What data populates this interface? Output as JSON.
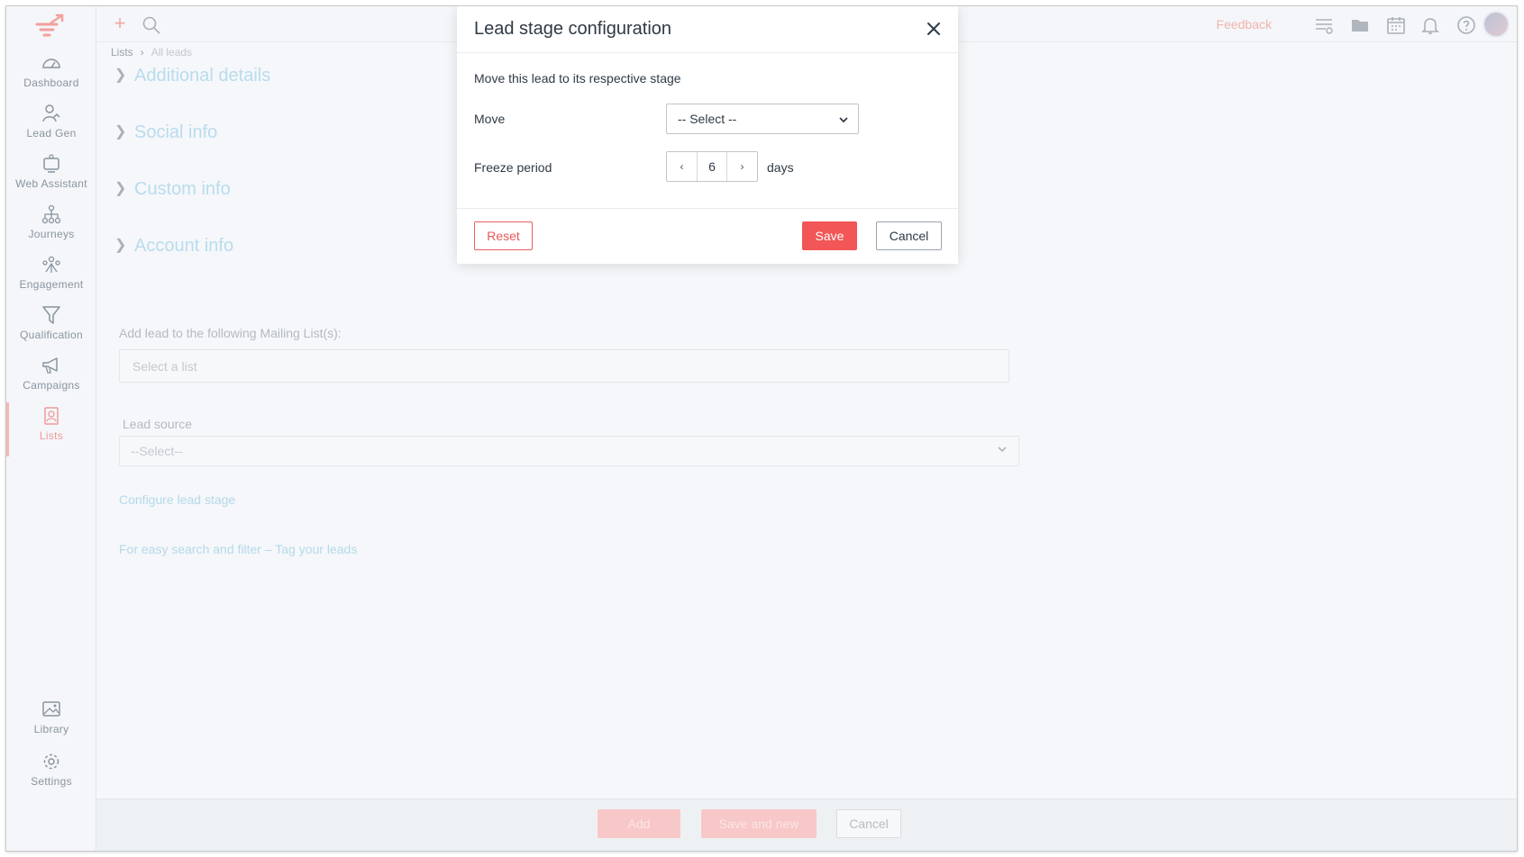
{
  "sidebar": {
    "items": [
      {
        "label": "Dashboard",
        "icon": "dashboard-icon"
      },
      {
        "label": "Lead Gen",
        "icon": "lead-gen-icon"
      },
      {
        "label": "Web Assistant",
        "icon": "web-assistant-icon"
      },
      {
        "label": "Journeys",
        "icon": "journeys-icon"
      },
      {
        "label": "Engagement",
        "icon": "engagement-icon"
      },
      {
        "label": "Qualification",
        "icon": "filter-icon"
      },
      {
        "label": "Campaigns",
        "icon": "megaphone-icon"
      },
      {
        "label": "Lists",
        "icon": "contact-card-icon"
      }
    ],
    "bottom_items": [
      {
        "label": "Library",
        "icon": "image-icon"
      },
      {
        "label": "Settings",
        "icon": "gear-icon"
      }
    ],
    "active_item": "Lists"
  },
  "topbar": {
    "feedback_label": "Feedback"
  },
  "breadcrumb": {
    "root": "Lists",
    "current": "All leads"
  },
  "sections": [
    "Additional details",
    "Social info",
    "Custom info",
    "Account info"
  ],
  "mailing_list": {
    "label": "Add lead to the following Mailing List(s):",
    "placeholder": "Select a list"
  },
  "lead_source": {
    "label": "Lead source",
    "value": "--Select--"
  },
  "links": {
    "configure": "Configure lead stage",
    "tag": "For easy search and filter – Tag your leads"
  },
  "footer": {
    "add_label": "Add",
    "save_new_label": "Save and new",
    "cancel_label": "Cancel"
  },
  "modal": {
    "title": "Lead stage configuration",
    "description": "Move this lead to its respective stage",
    "move_label": "Move",
    "move_value": "-- Select --",
    "freeze_label": "Freeze period",
    "freeze_value": "6",
    "freeze_unit": "days",
    "reset_label": "Reset",
    "save_label": "Save",
    "cancel_label": "Cancel"
  },
  "colors": {
    "accent": "#f25656",
    "link": "#b5d9ea"
  }
}
